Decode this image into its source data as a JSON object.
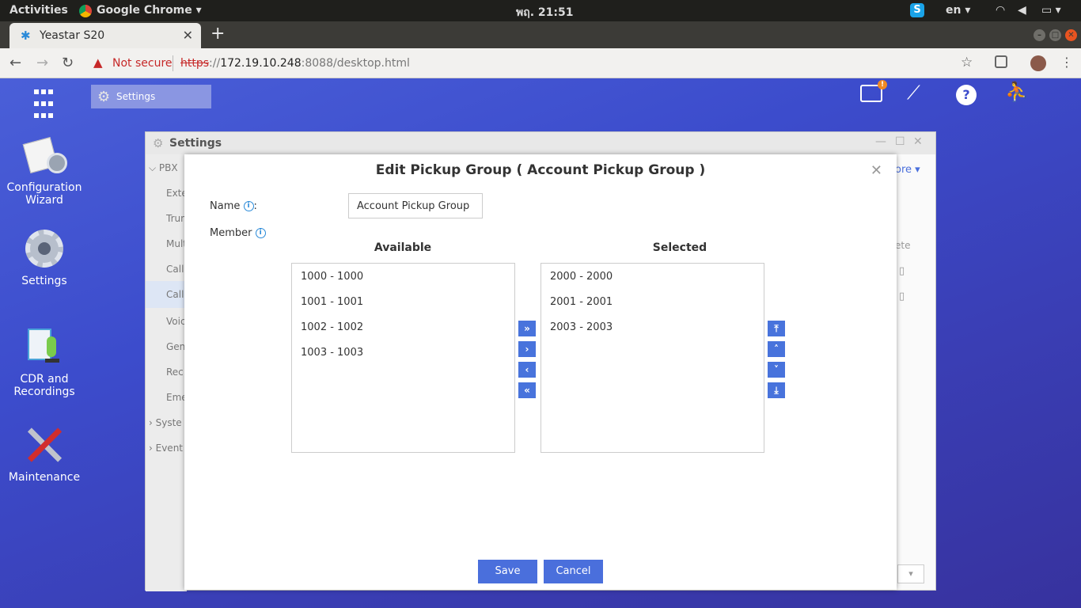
{
  "system": {
    "activities": "Activities",
    "app_name": "Google Chrome",
    "clock": "พฤ. 21:51",
    "language": "en"
  },
  "browser": {
    "tab_title": "Yeastar S20",
    "security_label": "Not secure",
    "url_scheme": "https",
    "url_sep": "://",
    "url_host": "172.19.10.248",
    "url_rest": ":8088/desktop.html"
  },
  "desktop": {
    "taskbar_item": "Settings",
    "icons": [
      {
        "label1": "Configuration",
        "label2": "Wizard"
      },
      {
        "label1": "Settings",
        "label2": ""
      },
      {
        "label1": "CDR and",
        "label2": "Recordings"
      },
      {
        "label1": "Maintenance",
        "label2": ""
      }
    ],
    "notification_badge": "!"
  },
  "settings_window": {
    "title": "Settings",
    "sidebar": [
      "PBX",
      "Exte",
      "Trun",
      "Mult",
      "Call",
      "Call",
      "Voic",
      "Gen",
      "Rec",
      "Eme",
      "Syste",
      "Event"
    ],
    "right_more": "ore",
    "right_col": "ete"
  },
  "dialog": {
    "title": "Edit Pickup Group ( Account Pickup Group )",
    "name_label": "Name",
    "name_value": "Account Pickup Group",
    "member_label": "Member",
    "available_header": "Available",
    "selected_header": "Selected",
    "available_items": [
      "1000 - 1000",
      "1001 - 1001",
      "1002 - 1002",
      "1003 - 1003"
    ],
    "selected_items": [
      "2000 - 2000",
      "2001 - 2001",
      "2003 - 2003"
    ],
    "save_label": "Save",
    "cancel_label": "Cancel"
  }
}
